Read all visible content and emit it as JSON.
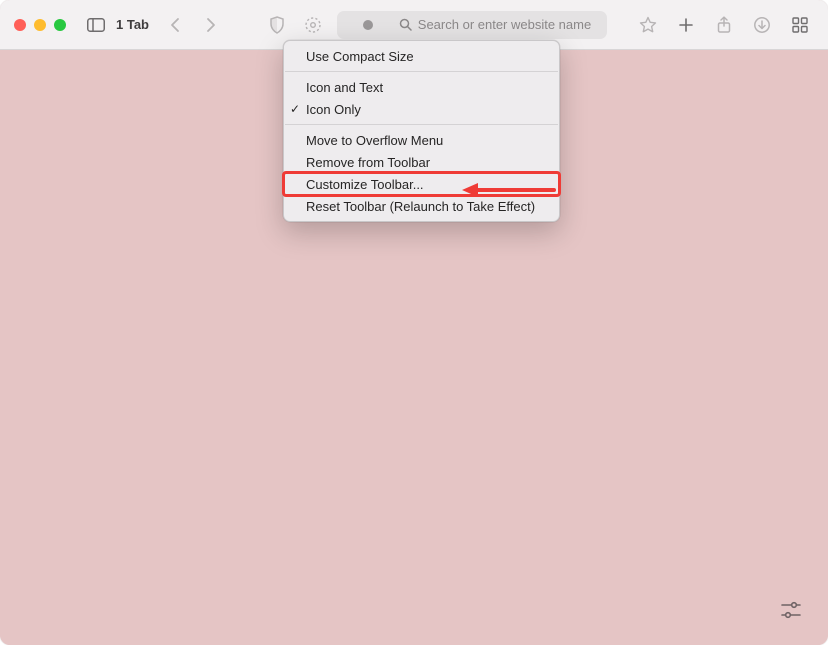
{
  "tab_label": "1 Tab",
  "url_placeholder": "Search or enter website name",
  "menu": {
    "compact": "Use Compact Size",
    "icon_text": "Icon and Text",
    "icon_only": "Icon Only",
    "move_overflow": "Move to Overflow Menu",
    "remove": "Remove from Toolbar",
    "customize": "Customize Toolbar...",
    "reset": "Reset Toolbar (Relaunch to Take Effect)"
  }
}
